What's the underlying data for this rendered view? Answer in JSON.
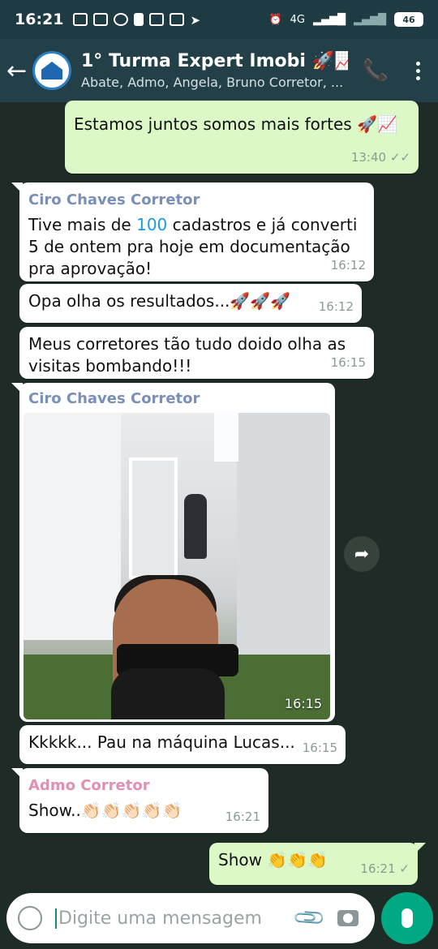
{
  "status_bar": {
    "time": "16:21",
    "network": "4G",
    "battery": "46"
  },
  "header": {
    "title": "1° Turma Expert Imobi 🚀📈",
    "members": "Abate, Admo, Angela, Bruno Corretor, ..."
  },
  "messages": [
    {
      "type": "out",
      "text": "Estamos juntos somos mais fortes 🚀📈",
      "time": "13:40"
    },
    {
      "type": "in",
      "sender": "Ciro Chaves Corretor",
      "text_pre": "Tive mais de ",
      "text_num": "100",
      "text_post": " cadastros e já converti 5 de ontem pra hoje em documentação pra aprovação!",
      "time": "16:12"
    },
    {
      "type": "in",
      "text": "Opa olha os resultados...🚀🚀🚀",
      "time": "16:12"
    },
    {
      "type": "in",
      "text": "Meus corretores tão tudo doido olha as visitas bombando!!!",
      "time": "16:15"
    },
    {
      "type": "in-image",
      "sender": "Ciro Chaves Corretor",
      "time": "16:15"
    },
    {
      "type": "in",
      "text": "Kkkkk... Pau na máquina Lucas...",
      "time": "16:15"
    },
    {
      "type": "in",
      "sender": "Admo Corretor",
      "text": "Show..👏🏻👏🏻👏🏻👏🏻👏🏻",
      "time": "16:21"
    },
    {
      "type": "out",
      "text": "Show 👏👏👏",
      "time": "16:21"
    }
  ],
  "colors": {
    "sender_ciro": "#7a8fb8",
    "sender_admo": "#e08fb5",
    "accent": "#00a884"
  },
  "input": {
    "placeholder": "Digite uma mensagem"
  }
}
